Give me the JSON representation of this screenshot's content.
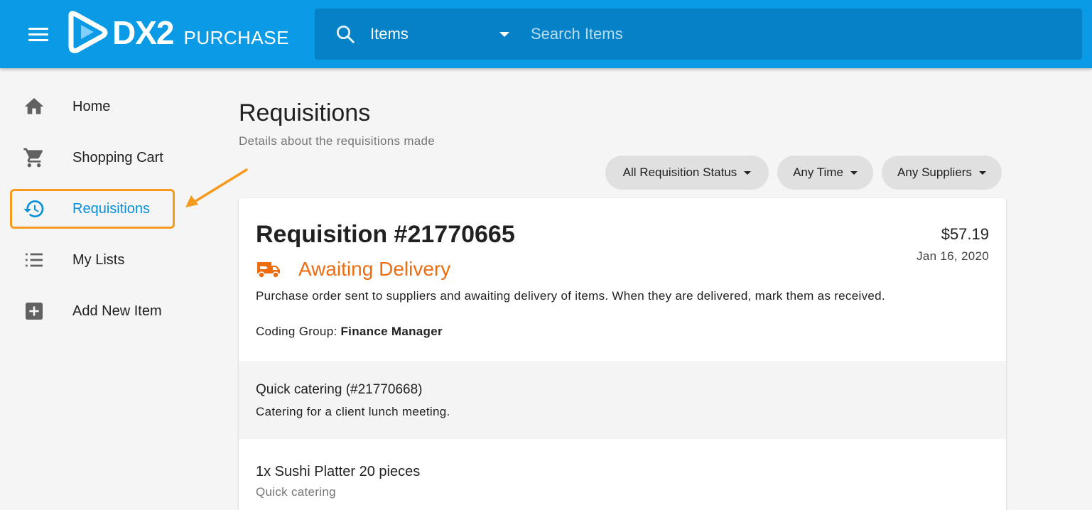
{
  "header": {
    "brand_name": "DX2",
    "brand_product": "PURCHASE",
    "search_scope": "Items",
    "search_placeholder": "Search Items"
  },
  "sidebar": {
    "items": [
      {
        "label": "Home",
        "icon": "home-icon"
      },
      {
        "label": "Shopping Cart",
        "icon": "cart-icon"
      },
      {
        "label": "Requisitions",
        "icon": "history-icon",
        "active": true
      },
      {
        "label": "My Lists",
        "icon": "list-icon"
      },
      {
        "label": "Add New Item",
        "icon": "add-box-icon"
      }
    ]
  },
  "page": {
    "title": "Requisitions",
    "subtitle": "Details about the requisitions made"
  },
  "filters": {
    "status": "All Requisition Status",
    "time": "Any Time",
    "suppliers": "Any Suppliers"
  },
  "requisition": {
    "title": "Requisition #21770665",
    "amount": "$57.19",
    "date": "Jan 16, 2020",
    "status": "Awaiting Delivery",
    "status_description": "Purchase order sent to suppliers and awaiting delivery of items. When they are delivered, mark them as received.",
    "coding_group_label": "Coding Group:",
    "coding_group_value": "Finance Manager",
    "group": {
      "title": "Quick catering (#21770668)",
      "description": "Catering for a client lunch meeting."
    },
    "line_item": {
      "title": "1x Sushi Platter 20 pieces",
      "subtitle": "Quick catering"
    }
  },
  "colors": {
    "app_bar": "#0a9ae6",
    "search_bar": "#0582c7",
    "active_nav": "#0a8fda",
    "highlight": "#f59a1c",
    "status_orange": "#ef6c10"
  }
}
